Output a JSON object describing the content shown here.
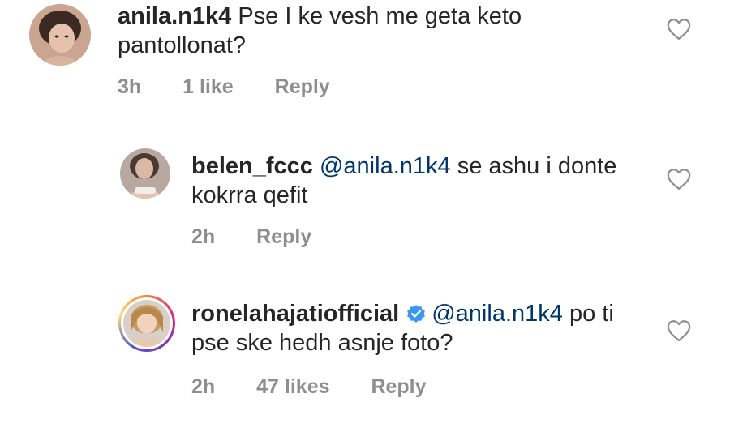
{
  "comments": [
    {
      "username": "anila.n1k4",
      "text": "Pse I ke vesh me geta keto pantollonat?",
      "time": "3h",
      "likes": "1 like",
      "reply_label": "Reply"
    },
    {
      "username": "belen_fccc",
      "mention": "@anila.n1k4",
      "text": "se ashu i donte kokrra qefit",
      "time": "2h",
      "reply_label": "Reply"
    },
    {
      "username": "ronelahajatiofficial",
      "mention": "@anila.n1k4",
      "text": "po ti pse ske hedh asnje foto?",
      "time": "2h",
      "likes": "47 likes",
      "reply_label": "Reply"
    }
  ],
  "icons": {
    "like": "heart-outline-icon",
    "verified": "verified-badge-icon"
  },
  "colors": {
    "text": "#262626",
    "mention": "#00376b",
    "meta": "#8e8e8e",
    "verified": "#3897f0"
  }
}
